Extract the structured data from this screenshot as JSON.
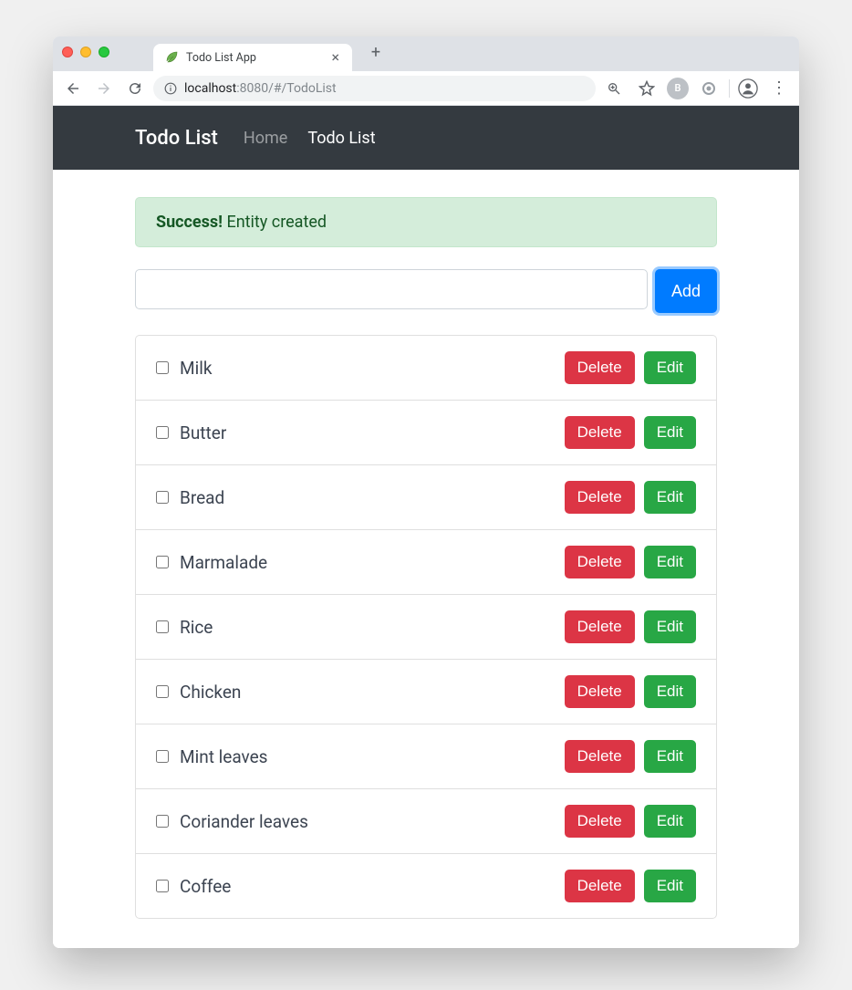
{
  "chrome": {
    "tab_title": "Todo List App",
    "url_host": "localhost",
    "url_port": ":8080",
    "url_path": "/#/TodoList"
  },
  "navbar": {
    "brand": "Todo List",
    "links": [
      {
        "label": "Home",
        "active": false
      },
      {
        "label": "Todo List",
        "active": true
      }
    ]
  },
  "alert": {
    "strong": "Success!",
    "text": " Entity created"
  },
  "add": {
    "input_value": "",
    "button_label": "Add"
  },
  "actions": {
    "delete_label": "Delete",
    "edit_label": "Edit"
  },
  "items": [
    {
      "label": "Milk",
      "checked": false
    },
    {
      "label": "Butter",
      "checked": false
    },
    {
      "label": "Bread",
      "checked": false
    },
    {
      "label": "Marmalade",
      "checked": false
    },
    {
      "label": "Rice",
      "checked": false
    },
    {
      "label": "Chicken",
      "checked": false
    },
    {
      "label": "Mint leaves",
      "checked": false
    },
    {
      "label": "Coriander leaves",
      "checked": false
    },
    {
      "label": "Coffee",
      "checked": false
    }
  ]
}
